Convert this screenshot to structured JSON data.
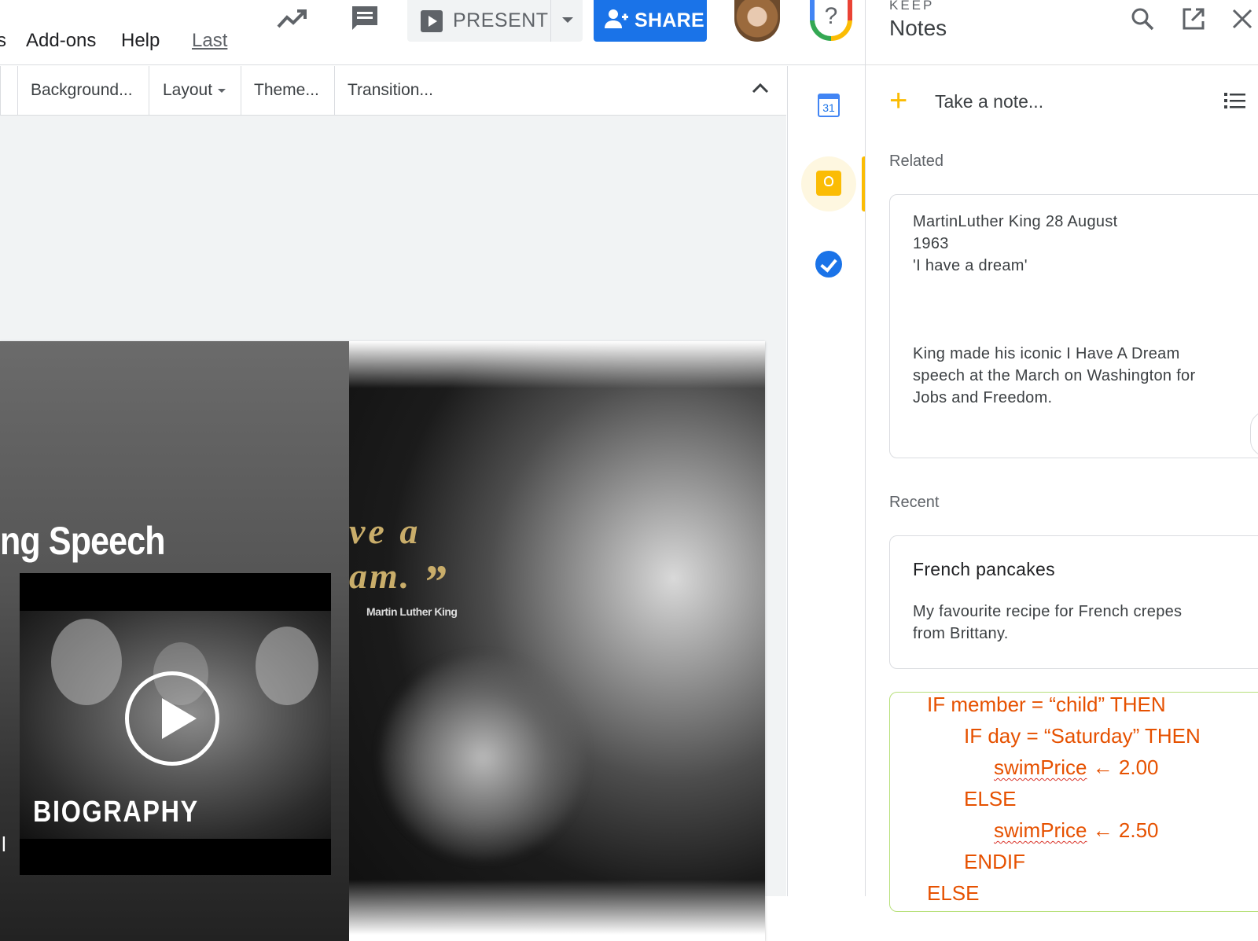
{
  "menu": {
    "items": [
      "s",
      "Add-ons",
      "Help"
    ],
    "last_edit": "Last"
  },
  "topbar": {
    "present_label": "PRESENT",
    "share_label": "SHARE",
    "help_glyph": "?"
  },
  "toolbar": {
    "background": "Background...",
    "layout": "Layout",
    "theme": "Theme...",
    "transition": "Transition..."
  },
  "slide": {
    "title": "ng Speech",
    "video_label": "BIOGRAPHY",
    "quote_line1": "ve a",
    "quote_line2": "am.",
    "quote_mark": "”",
    "quote_attribution": "Martin Luther King",
    "edge_glyph": "l"
  },
  "rail": {
    "calendar_day": "31"
  },
  "keep": {
    "brand": "KEEP",
    "title": "Notes",
    "take_note": "Take a note...",
    "related_label": "Related",
    "recent_label": "Recent",
    "related_note": {
      "line1": "MartinLuther King  28 August",
      "line2": "1963",
      "line3": "'I have a dream'",
      "body1": "King made his iconic I Have A Dream",
      "body2": "speech at the March on Washington for",
      "body3": "Jobs and Freedom."
    },
    "recent_note": {
      "title": "French pancakes",
      "body1": "My favourite recipe for French crepes",
      "body2": "from Brittany."
    },
    "code_note": {
      "l1": "IF member = “child” THEN",
      "l2": "IF day = “Saturday” THEN",
      "l3_var": "swimPrice",
      "l3_rest": " ← 2.00",
      "l4": "ELSE",
      "l5_var": "swimPrice",
      "l5_rest": " ← 2.50",
      "l6": "ENDIF",
      "l7": "ELSE"
    }
  },
  "colors": {
    "accent_blue": "#1a73e8",
    "keep_yellow": "#fbbc04",
    "code_orange": "#e65100"
  }
}
